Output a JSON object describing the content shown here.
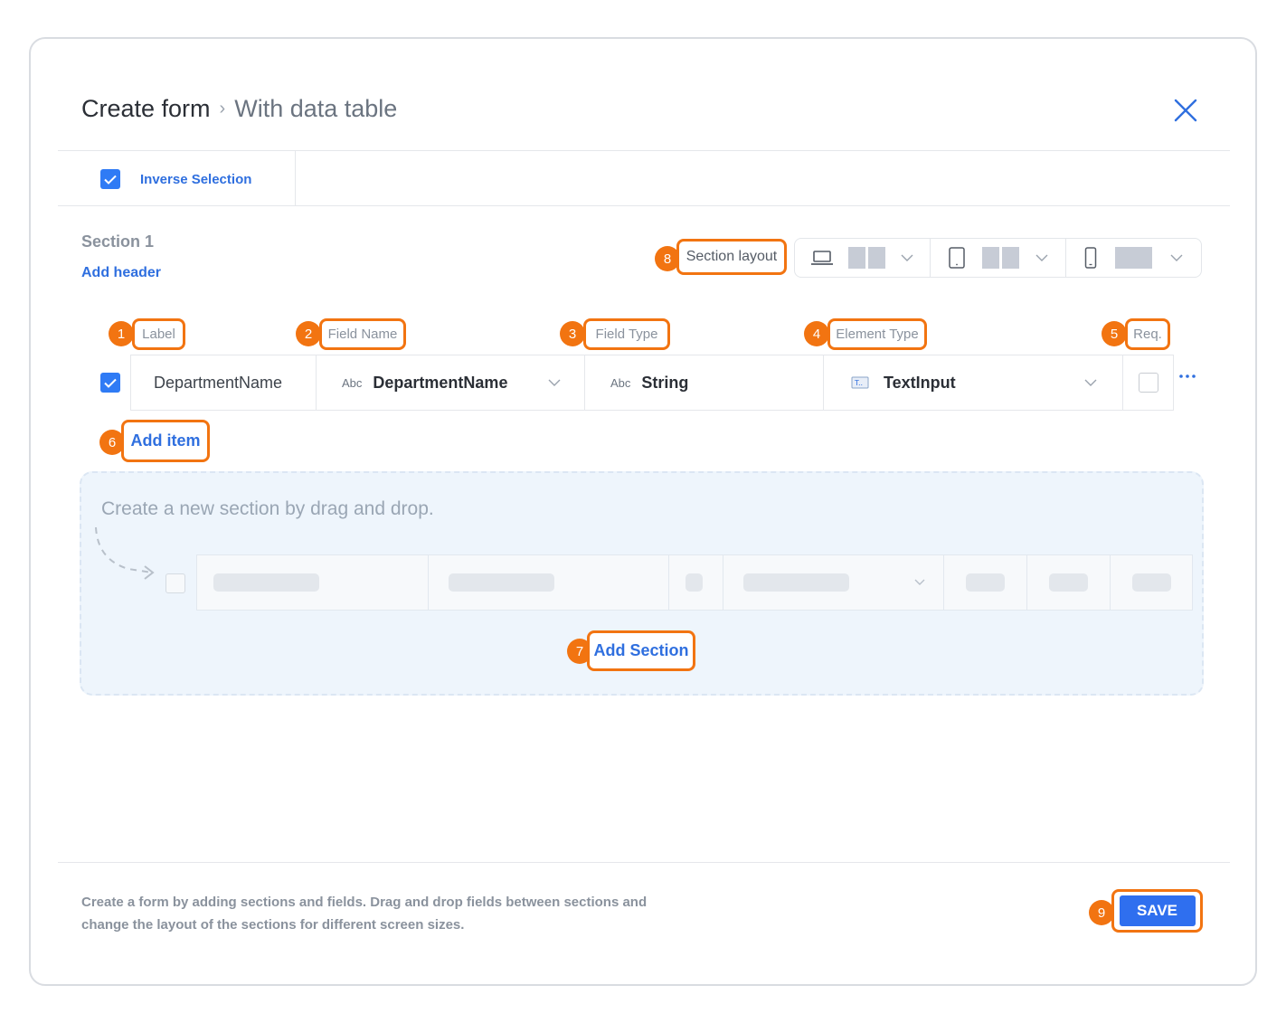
{
  "header": {
    "title": "Create form",
    "separator": "›",
    "subtitle": "With data table"
  },
  "toolbar": {
    "inverse_selection_label": "Inverse Selection",
    "inverse_selection_checked": true
  },
  "section": {
    "title": "Section 1",
    "add_header_label": "Add header",
    "layout_label": "Section layout",
    "layout_devices": [
      "laptop-icon",
      "tablet-icon",
      "phone-icon"
    ]
  },
  "table": {
    "columns": [
      "Label",
      "Field Name",
      "Field Type",
      "Element Type",
      "Req."
    ],
    "rows": [
      {
        "selected": true,
        "label": "DepartmentName",
        "field_name_prefix": "Abc",
        "field_name": "DepartmentName",
        "field_type_prefix": "Abc",
        "field_type": "String",
        "element_type": "TextInput",
        "required": false
      }
    ],
    "add_item_label": "Add item"
  },
  "dropzone": {
    "hint": "Create a new section by drag and drop.",
    "add_section_label": "Add Section"
  },
  "footer": {
    "help_text": "Create a form by adding sections and fields. Drag and drop fields between sections and change the layout of the sections for different screen sizes.",
    "save_label": "SAVE"
  },
  "annotations": [
    "1",
    "2",
    "3",
    "4",
    "5",
    "6",
    "7",
    "8",
    "9"
  ],
  "colors": {
    "accent": "#2f6fef",
    "annotation": "#f27411"
  }
}
